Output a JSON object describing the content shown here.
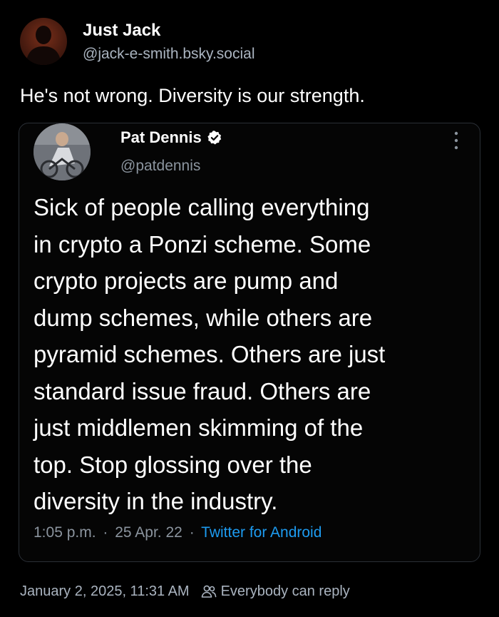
{
  "author": {
    "display_name": "Just Jack",
    "handle": "@jack-e-smith.bsky.social"
  },
  "post": {
    "text": "He's not wrong. Diversity is our strength."
  },
  "quoted": {
    "display_name": "Pat Dennis",
    "handle": "@patdennis",
    "verified": true,
    "body": "Sick of people calling everything\nin crypto a Ponzi scheme. Some\ncrypto projects are pump and\ndump schemes, while others are\npyramid schemes. Others are just\nstandard issue fraud. Others are\njust middlemen skimming of the\ntop. Stop glossing over the\ndiversity in the industry.",
    "time": "1:05 p.m.",
    "date": "25 Apr. 22",
    "source": "Twitter for Android",
    "separator": "·"
  },
  "footer": {
    "timestamp": "January 2, 2025, 11:31 AM",
    "reply_setting": "Everybody can reply",
    "icon": "people-icon"
  },
  "colors": {
    "background": "#000000",
    "secondary_text": "#aab4c0",
    "link": "#1d9bf0",
    "verified": "#ffffff"
  }
}
